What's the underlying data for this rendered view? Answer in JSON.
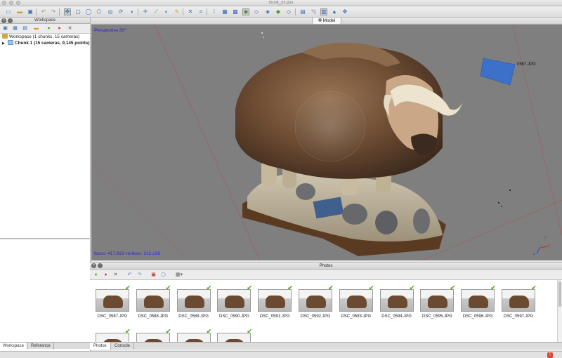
{
  "window": {
    "title": "musk_ox.psx"
  },
  "workspace": {
    "title": "Workspace",
    "root_label": "Workspace (1 chunks, 15 cameras)",
    "chunk_label": "Chunk 1 (15 cameras, 9,145 points)"
  },
  "left_tabs": [
    "Workspace",
    "Reference"
  ],
  "model": {
    "tab_label": "Model",
    "projection_label": "Perspective 30°",
    "stats_label": "faces: 417,933 vertices: 212,236",
    "camera_label": "0587.JPG",
    "axis_labels": {
      "x": "x",
      "y": "y",
      "z": "z"
    }
  },
  "photos": {
    "title": "Photos",
    "items": [
      {
        "label": "DSC_0587.JPG"
      },
      {
        "label": "DSC_0588.JPG"
      },
      {
        "label": "DSC_0589.JPG"
      },
      {
        "label": "DSC_0590.JPG"
      },
      {
        "label": "DSC_0591.JPG"
      },
      {
        "label": "DSC_0592.JPG"
      },
      {
        "label": "DSC_0593.JPG"
      },
      {
        "label": "DSC_0594.JPG"
      },
      {
        "label": "DSC_0595.JPG"
      },
      {
        "label": "DSC_0596.JPG"
      },
      {
        "label": "DSC_0597.JPG"
      },
      {
        "label": ""
      },
      {
        "label": ""
      },
      {
        "label": ""
      },
      {
        "label": ""
      }
    ]
  },
  "bottom_tabs": [
    "Photos",
    "Console"
  ],
  "colors": {
    "accent": "#3a6fb5",
    "check": "#5dae2d",
    "viewport_bg": "#7f7f7f",
    "label_blue": "#2323d0"
  }
}
